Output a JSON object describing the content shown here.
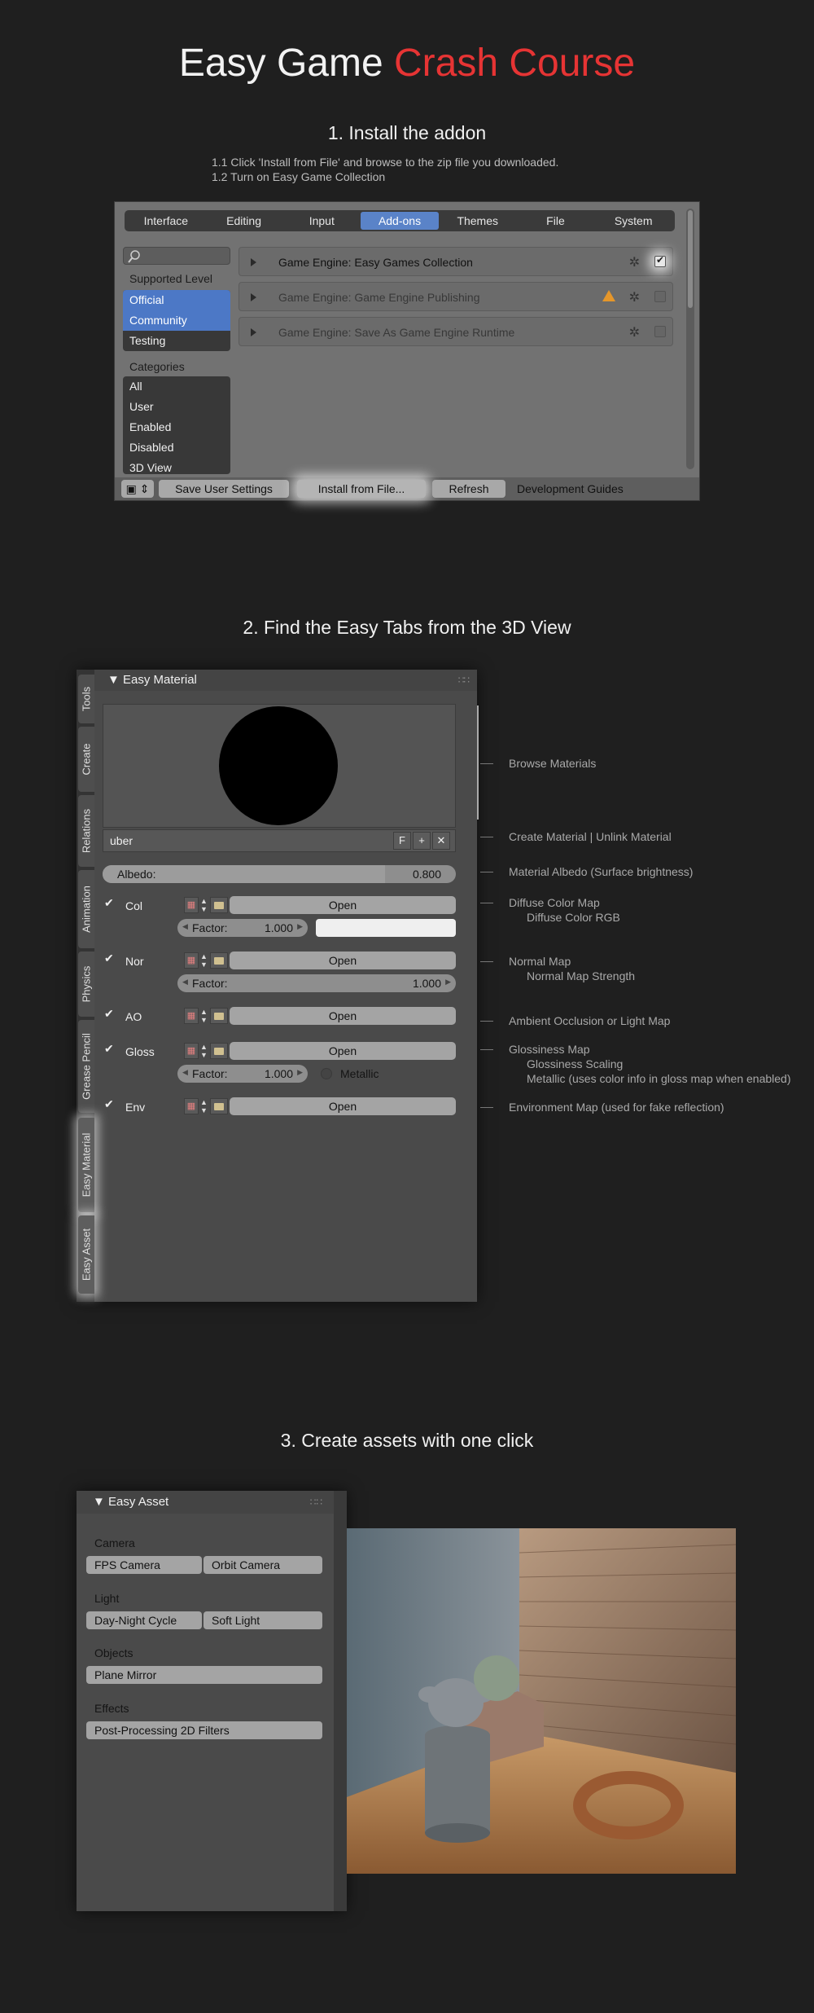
{
  "header": {
    "title_prefix": "Easy Game",
    "title_accent": "Crash Course",
    "accent_color": "#e63434"
  },
  "step1": {
    "title": "1. Install the addon",
    "note_1": "1.1 Click 'Install from File' and browse to the zip file you downloaded.",
    "note_2": "1.2 Turn on Easy Game Collection",
    "tabs": [
      "Interface",
      "Editing",
      "Input",
      "Add-ons",
      "Themes",
      "File",
      "System"
    ],
    "active_tab": "Add-ons",
    "supported_level_label": "Supported Level",
    "levels": [
      "Official",
      "Community",
      "Testing"
    ],
    "categories_label": "Categories",
    "categories": [
      "All",
      "User",
      "Enabled",
      "Disabled",
      "3D View"
    ],
    "addons": [
      {
        "name": "Game Engine: Easy Games Collection",
        "enabled": true
      },
      {
        "name": "Game Engine: Game Engine Publishing",
        "enabled": false
      },
      {
        "name": "Game Engine: Save As Game Engine Runtime",
        "enabled": false
      }
    ],
    "bottom": {
      "save": "Save User Settings",
      "install": "Install from File...",
      "refresh": "Refresh",
      "guides": "Development Guides"
    }
  },
  "step2": {
    "title": "2. Find the Easy Tabs from the 3D View",
    "side_tabs": [
      "Tools",
      "Create",
      "Relations",
      "Animation",
      "Physics",
      "Grease Pencil",
      "Easy Material",
      "Easy Asset"
    ],
    "panel_title": "Easy Material",
    "material_name": "uber",
    "mat_buttons": [
      "F",
      "+",
      "✕"
    ],
    "albedo_label": "Albedo:",
    "albedo_value": "0.800",
    "albedo_fraction": 0.8,
    "open_label": "Open",
    "factor_label": "Factor:",
    "rows": {
      "col": "Col",
      "col_factor": "1.000",
      "nor": "Nor",
      "nor_factor": "1.000",
      "ao": "AO",
      "gloss": "Gloss",
      "gloss_factor": "1.000",
      "metallic": "Metallic",
      "env": "Env"
    },
    "callouts": {
      "browse": "Browse Materials",
      "create": "Create Material  | Unlink Material",
      "albedo": "Material Albedo (Surface brightness)",
      "diffuse_1": "Diffuse Color Map",
      "diffuse_2": "Diffuse Color RGB",
      "normal_1": "Normal Map",
      "normal_2": "Normal Map Strength",
      "ao": "Ambient Occlusion or Light Map",
      "gloss_1": "Glossiness Map",
      "gloss_2": "Glossiness Scaling",
      "gloss_3": "Metallic (uses color info in gloss map when enabled)",
      "env": "Environment Map (used for fake reflection)"
    }
  },
  "step3": {
    "title": "3. Create assets with one click",
    "panel_title": "Easy Asset",
    "camera_label": "Camera",
    "fps_camera": "FPS Camera",
    "orbit_camera": "Orbit Camera",
    "light_label": "Light",
    "day_night": "Day-Night Cycle",
    "soft_light": "Soft Light",
    "objects_label": "Objects",
    "plane_mirror": "Plane Mirror",
    "effects_label": "Effects",
    "post_filters": "Post-Processing 2D Filters"
  }
}
